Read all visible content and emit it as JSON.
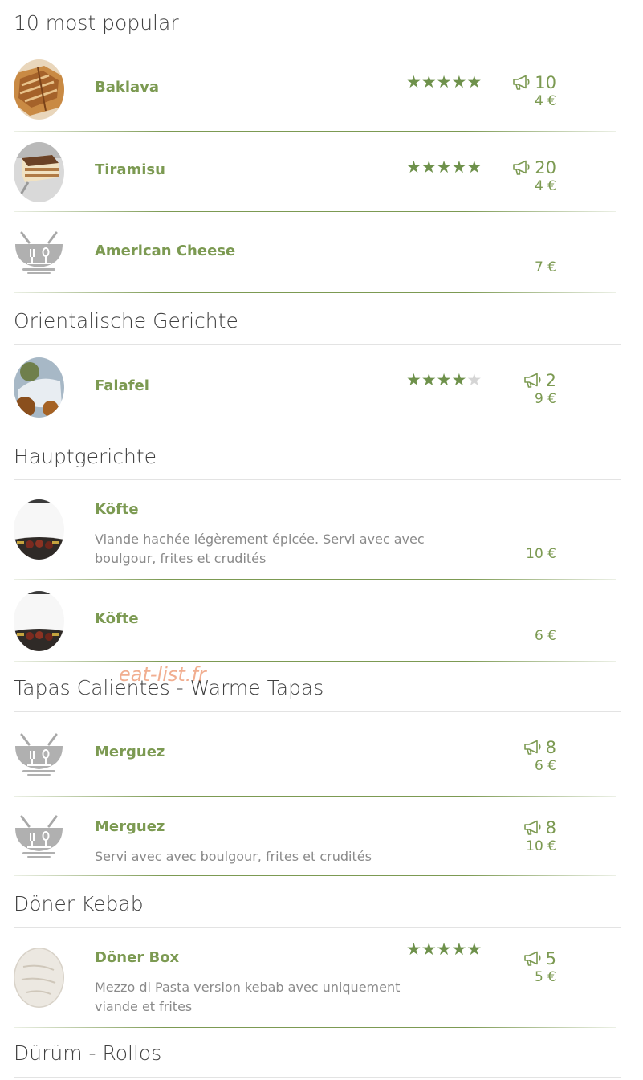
{
  "watermark": "eat-list.fr",
  "colors": {
    "accent": "#7c9a52",
    "star_on": "#6e914b",
    "star_off": "#d5d5d5",
    "heading": "#3f3f3f",
    "description": "#8a8a8a"
  },
  "sections": [
    {
      "title": "10 most popular",
      "items": [
        {
          "name": "Baklava",
          "description": "",
          "rating": 5,
          "votes": "10",
          "price": "4 €",
          "image": "baklava-photo"
        },
        {
          "name": "Tiramisu",
          "description": "",
          "rating": 5,
          "votes": "20",
          "price": "4 €",
          "image": "tiramisu-photo"
        },
        {
          "name": "American Cheese",
          "description": "",
          "rating": null,
          "votes": null,
          "price": "7 €",
          "image": "placeholder-bowl-icon"
        }
      ]
    },
    {
      "title": "Orientalische Gerichte",
      "items": [
        {
          "name": "Falafel",
          "description": "",
          "rating": 4,
          "votes": "2",
          "price": "9 €",
          "image": "falafel-photo"
        }
      ]
    },
    {
      "title": "Hauptgerichte",
      "items": [
        {
          "name": "Köfte",
          "description": "Viande hachée légèrement épicée. Servi avec avec boulgour, frites et crudités",
          "rating": null,
          "votes": null,
          "price": "10 €",
          "image": "kofte-photo"
        },
        {
          "name": "Köfte",
          "description": "",
          "rating": null,
          "votes": null,
          "price": "6 €",
          "image": "kofte-photo"
        }
      ]
    },
    {
      "title": "Tapas Calientes - Warme Tapas",
      "items": [
        {
          "name": "Merguez",
          "description": "",
          "rating": null,
          "votes": "8",
          "price": "6 €",
          "image": "placeholder-bowl-icon"
        },
        {
          "name": "Merguez",
          "description": "Servi avec avec boulgour, frites et crudités",
          "rating": null,
          "votes": "8",
          "price": "10 €",
          "image": "placeholder-bowl-icon"
        }
      ]
    },
    {
      "title": "Döner Kebab",
      "items": [
        {
          "name": "Döner Box",
          "description": "Mezzo di Pasta version kebab avec uniquement viande et frites",
          "rating": 5,
          "votes": "5",
          "price": "5 €",
          "image": "doner-box-photo"
        }
      ]
    },
    {
      "title": "Dürüm - Rollos",
      "items": []
    }
  ]
}
